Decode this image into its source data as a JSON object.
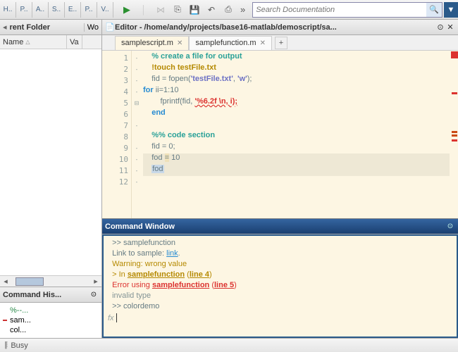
{
  "toolbar": {
    "ribbon_tabs": [
      "H..",
      "P..",
      "A..",
      "S..",
      "E..",
      "P..",
      "V.."
    ],
    "search_placeholder": "Search Documentation"
  },
  "folder_panel": {
    "title": "rent Folder",
    "title2": "Wo",
    "col_name": "Name",
    "col_val": "Va"
  },
  "cmdhist": {
    "title": "Command His...",
    "items": [
      "%--...",
      "sam...",
      "col..."
    ]
  },
  "editor": {
    "title": "Editor - /home/andy/projects/base16-matlab/demoscript/sa...",
    "tabs": [
      {
        "name": "samplescript.m",
        "active": true
      },
      {
        "name": "samplefunction.m",
        "active": false
      }
    ],
    "code": {
      "l1": "    % create a file for output",
      "l2": "    !touch testFile.txt",
      "l3_a": "    fid = fopen(",
      "l3_b": "'testFile.txt'",
      "l3_c": ", ",
      "l3_d": "'w'",
      "l3_e": ");",
      "l4_a": "for",
      "l4_b": " ii=1:10",
      "l5_a": "        fprintf(fid, ",
      "l5_b": "'%6.2f \\n, i);",
      "l6": "    end",
      "l8": "    %% code section",
      "l9": "    fid = 0;",
      "l10_a": "    fod ",
      "l10_b": "=",
      "l10_c": " 10",
      "l11": "fod"
    }
  },
  "cmdwin": {
    "title": "Command Window",
    "l1": "  >> samplefunction",
    "l2_a": "  Link to sample: ",
    "l2_b": "link",
    "l2_c": ".",
    "l3": "  Warning: wrong value",
    "l4_a": "  > In ",
    "l4_b": "samplefunction",
    "l4_c": " (",
    "l4_d": "line 4",
    "l4_e": ")",
    "l5_a": "  Error using ",
    "l5_b": "samplefunction",
    "l5_c": " (",
    "l5_d": "line 5",
    "l5_e": ")",
    "l6": "  invalid type",
    "l7": "  >> colordemo",
    "fx": "fx"
  },
  "status": {
    "text": "Busy"
  }
}
